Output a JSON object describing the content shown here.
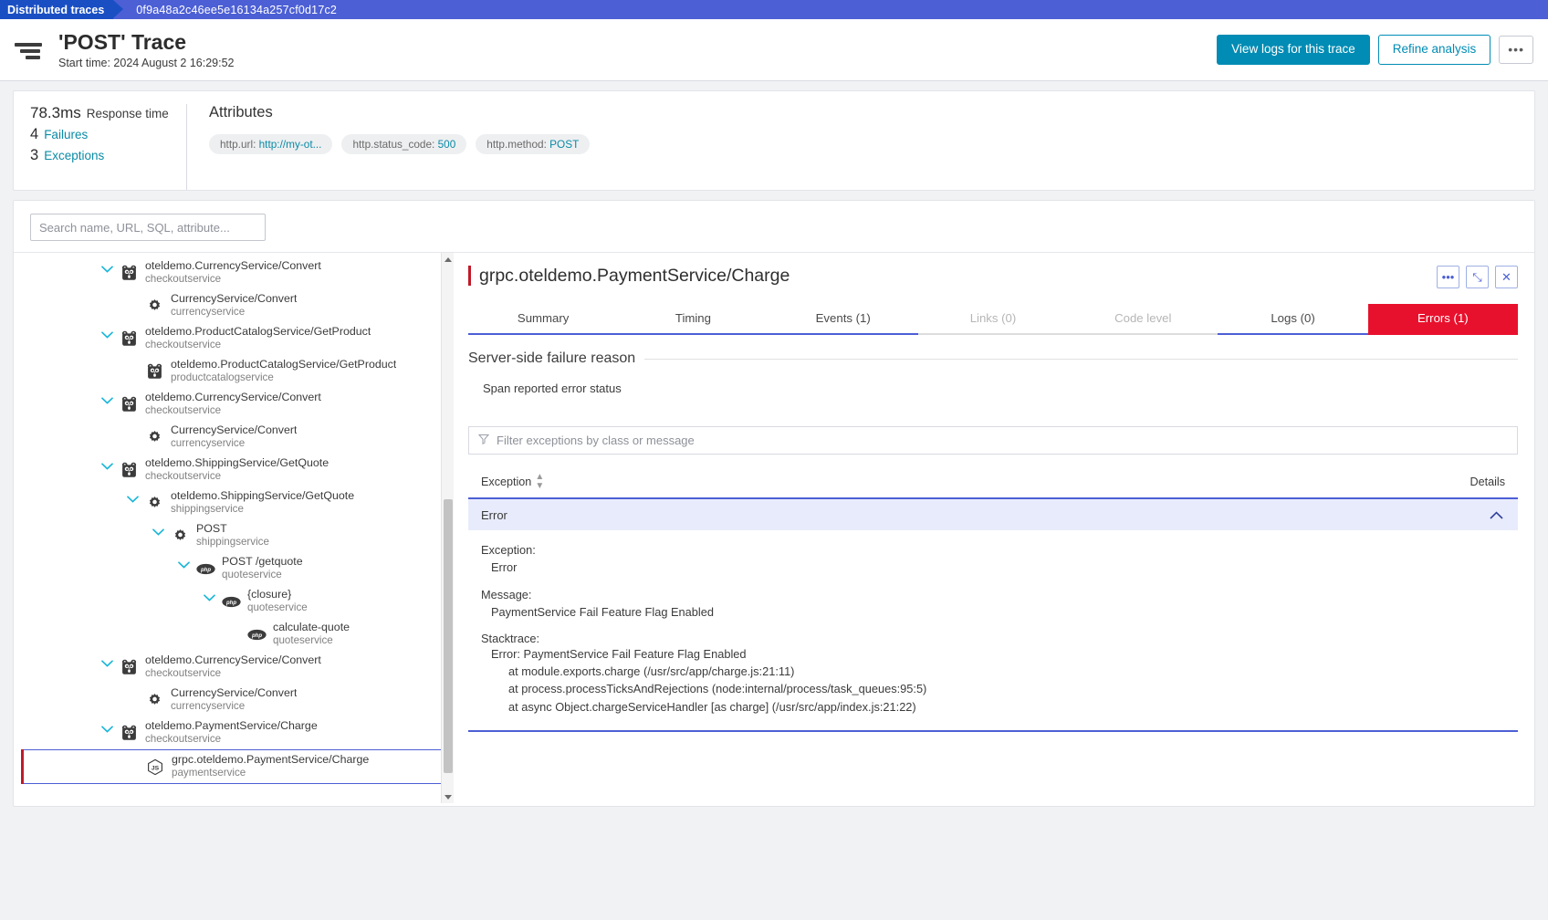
{
  "breadcrumb": {
    "root": "Distributed traces",
    "trace_id": "0f9a48a2c46ee5e16134a257cf0d17c2"
  },
  "header": {
    "title": "'POST' Trace",
    "subtitle": "Start time: 2024 August 2 16:29:52",
    "actions": {
      "view_logs": "View logs for this trace",
      "refine": "Refine analysis",
      "more": "•••"
    }
  },
  "summary": {
    "stats": [
      {
        "value": "78.3ms",
        "label": "Response time",
        "link": false
      },
      {
        "value": "4",
        "label": "Failures",
        "link": true
      },
      {
        "value": "3",
        "label": "Exceptions",
        "link": true
      }
    ],
    "attributes_title": "Attributes",
    "attributes": [
      {
        "key": "http.url:",
        "value": "http://my-ot..."
      },
      {
        "key": "http.status_code:",
        "value": "500"
      },
      {
        "key": "http.method:",
        "value": "POST"
      }
    ]
  },
  "search": {
    "placeholder": "Search name, URL, SQL, attribute..."
  },
  "tree": [
    {
      "indent": 0,
      "chevron": true,
      "icon": "gopher",
      "name": "oteldemo.CurrencyService/Convert",
      "service": "checkoutservice",
      "selected": false
    },
    {
      "indent": 1,
      "chevron": false,
      "icon": "gear",
      "name": "CurrencyService/Convert",
      "service": "currencyservice",
      "selected": false
    },
    {
      "indent": 0,
      "chevron": true,
      "icon": "gopher",
      "name": "oteldemo.ProductCatalogService/GetProduct",
      "service": "checkoutservice",
      "selected": false
    },
    {
      "indent": 1,
      "chevron": false,
      "icon": "gopher",
      "name": "oteldemo.ProductCatalogService/GetProduct",
      "service": "productcatalogservice",
      "selected": false
    },
    {
      "indent": 0,
      "chevron": true,
      "icon": "gopher",
      "name": "oteldemo.CurrencyService/Convert",
      "service": "checkoutservice",
      "selected": false
    },
    {
      "indent": 1,
      "chevron": false,
      "icon": "gear",
      "name": "CurrencyService/Convert",
      "service": "currencyservice",
      "selected": false
    },
    {
      "indent": 0,
      "chevron": true,
      "icon": "gopher",
      "name": "oteldemo.ShippingService/GetQuote",
      "service": "checkoutservice",
      "selected": false
    },
    {
      "indent": 1,
      "chevron": true,
      "icon": "gear",
      "name": "oteldemo.ShippingService/GetQuote",
      "service": "shippingservice",
      "selected": false
    },
    {
      "indent": 2,
      "chevron": true,
      "icon": "gear",
      "name": "POST",
      "service": "shippingservice",
      "selected": false
    },
    {
      "indent": 3,
      "chevron": true,
      "icon": "php",
      "name": "POST /getquote",
      "service": "quoteservice",
      "selected": false
    },
    {
      "indent": 4,
      "chevron": true,
      "icon": "php",
      "name": "{closure}",
      "service": "quoteservice",
      "selected": false
    },
    {
      "indent": 5,
      "chevron": false,
      "icon": "php",
      "name": "calculate-quote",
      "service": "quoteservice",
      "selected": false
    },
    {
      "indent": 0,
      "chevron": true,
      "icon": "gopher",
      "name": "oteldemo.CurrencyService/Convert",
      "service": "checkoutservice",
      "selected": false
    },
    {
      "indent": 1,
      "chevron": false,
      "icon": "gear",
      "name": "CurrencyService/Convert",
      "service": "currencyservice",
      "selected": false
    },
    {
      "indent": 0,
      "chevron": true,
      "icon": "gopher",
      "name": "oteldemo.PaymentService/Charge",
      "service": "checkoutservice",
      "selected": false
    },
    {
      "indent": 1,
      "chevron": false,
      "icon": "node",
      "name": "grpc.oteldemo.PaymentService/Charge",
      "service": "paymentservice",
      "selected": true
    }
  ],
  "detail": {
    "title": "grpc.oteldemo.PaymentService/Charge",
    "head_buttons": [
      {
        "name": "more-options",
        "glyph": "•••"
      },
      {
        "name": "expand",
        "glyph": "⤡"
      },
      {
        "name": "close",
        "glyph": "✕"
      }
    ],
    "tabs": [
      {
        "label": "Summary",
        "state": "normal"
      },
      {
        "label": "Timing",
        "state": "normal"
      },
      {
        "label": "Events (1)",
        "state": "normal"
      },
      {
        "label": "Links (0)",
        "state": "disabled"
      },
      {
        "label": "Code level",
        "state": "disabled"
      },
      {
        "label": "Logs (0)",
        "state": "normal"
      },
      {
        "label": "Errors (1)",
        "state": "active-error"
      }
    ],
    "section_title": "Server-side failure reason",
    "reason": "Span reported error status",
    "filter_placeholder": "Filter exceptions by class or message",
    "table": {
      "col_exception": "Exception",
      "col_details": "Details"
    },
    "exception_row": {
      "name": "Error"
    },
    "exception_detail": {
      "exception_label": "Exception:",
      "exception_value": "Error",
      "message_label": "Message:",
      "message_value": "PaymentService Fail Feature Flag Enabled",
      "stacktrace_label": "Stacktrace:",
      "stacktrace_lines": [
        "Error: PaymentService Fail Feature Flag Enabled",
        "at module.exports.charge (/usr/src/app/charge.js:21:11)",
        "at process.processTicksAndRejections (node:internal/process/task_queues:95:5)",
        "at async Object.chargeServiceHandler [as charge] (/usr/src/app/index.js:21:22)"
      ]
    }
  },
  "colors": {
    "breadcrumb_bg": "#4c5fd5",
    "breadcrumb_first": "#1a4fc4",
    "accent_teal": "#008cb4",
    "accent_link": "#0a8ba6",
    "error_red": "#e8112d",
    "title_red": "#c01a28",
    "tab_underline": "#4c5fd5",
    "row_highlight": "#e8ebfb"
  }
}
